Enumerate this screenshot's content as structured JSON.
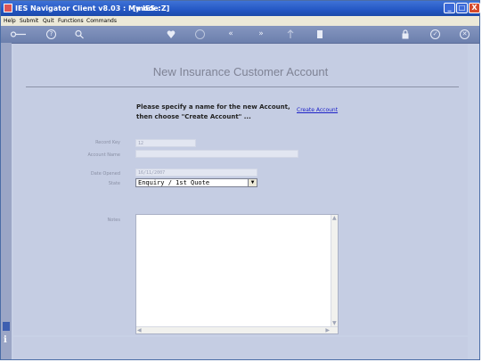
{
  "window": {
    "title": "IES Navigator Client v8.03 : My IES :",
    "mode": "[mode:Z]",
    "minimize": "_",
    "maximize": "□",
    "close": "X"
  },
  "menu": [
    "Help",
    "Submit",
    "Quit",
    "Functions",
    "Commands"
  ],
  "toolbar": {
    "help": "?",
    "search": "⚲",
    "prev": "«",
    "next": "»",
    "ok": "✓",
    "cancel": "✕"
  },
  "form": {
    "title": "New Insurance Customer Account",
    "instruction_line1": "Please specify a name for the new Account,",
    "instruction_line2": "then choose \"Create Account\" ...",
    "create_link": "Create Account",
    "record_key_label": "Record Key",
    "record_key_value": "12",
    "account_name_label": "Account Name",
    "account_name_value": "",
    "date_opened_label": "Date Opened",
    "date_opened_value": "16/11/2007",
    "state_label": "State",
    "state_value": "Enquiry / 1st Quote",
    "notes_label": "Notes",
    "notes_value": ""
  },
  "accent": "#2457c4",
  "link_color": "#1d22c8"
}
